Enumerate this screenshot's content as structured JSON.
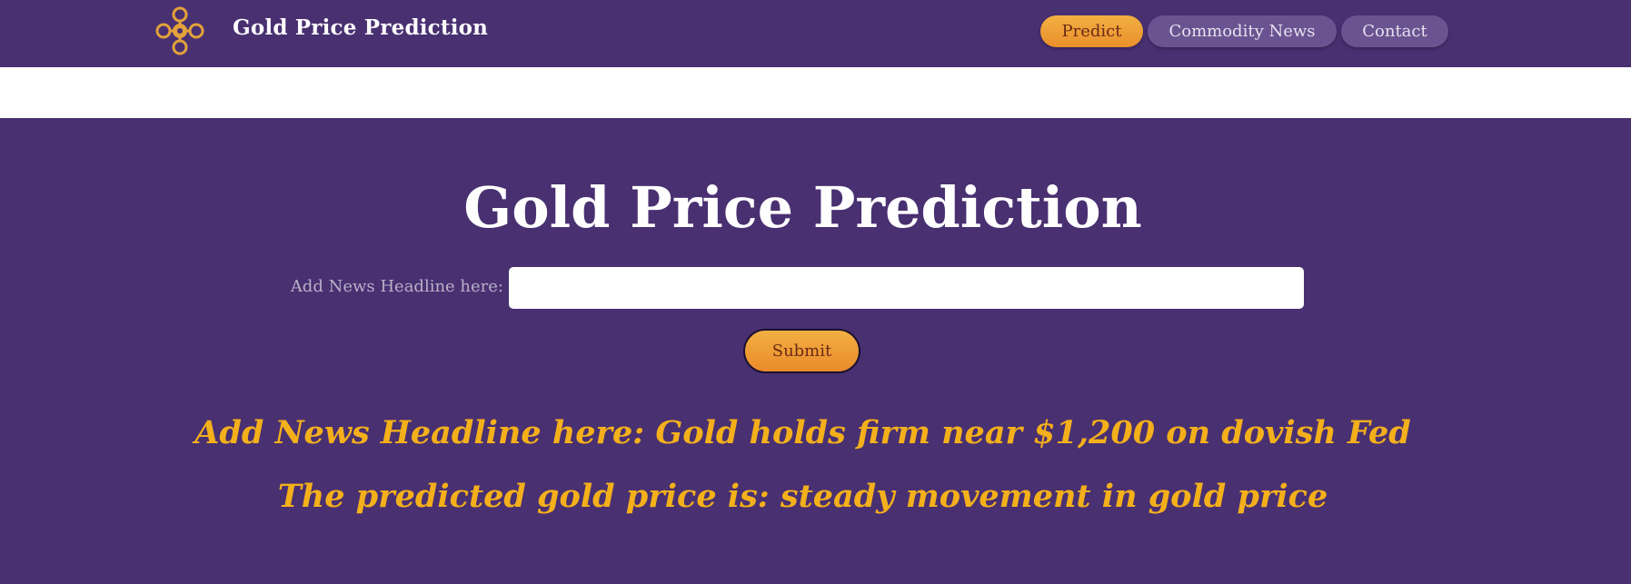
{
  "header": {
    "brand": "Gold Price Prediction",
    "logo_icon": "gold-ornament-icon",
    "nav": [
      {
        "label": "Predict",
        "active": true
      },
      {
        "label": "Commodity News",
        "active": false
      },
      {
        "label": "Contact",
        "active": false
      }
    ]
  },
  "main": {
    "title": "Gold Price Prediction",
    "input_label": "Add News Headline here:",
    "input_value": "",
    "submit_label": "Submit",
    "result_headline": "Add News Headline here: Gold holds firm near $1,200 on dovish Fed",
    "result_prediction": "The predicted gold price is: steady movement in gold price"
  },
  "colors": {
    "background": "#493071",
    "accent": "#f2a23a",
    "result_text": "#f4b01b",
    "nav_inactive": "#6a5390"
  }
}
